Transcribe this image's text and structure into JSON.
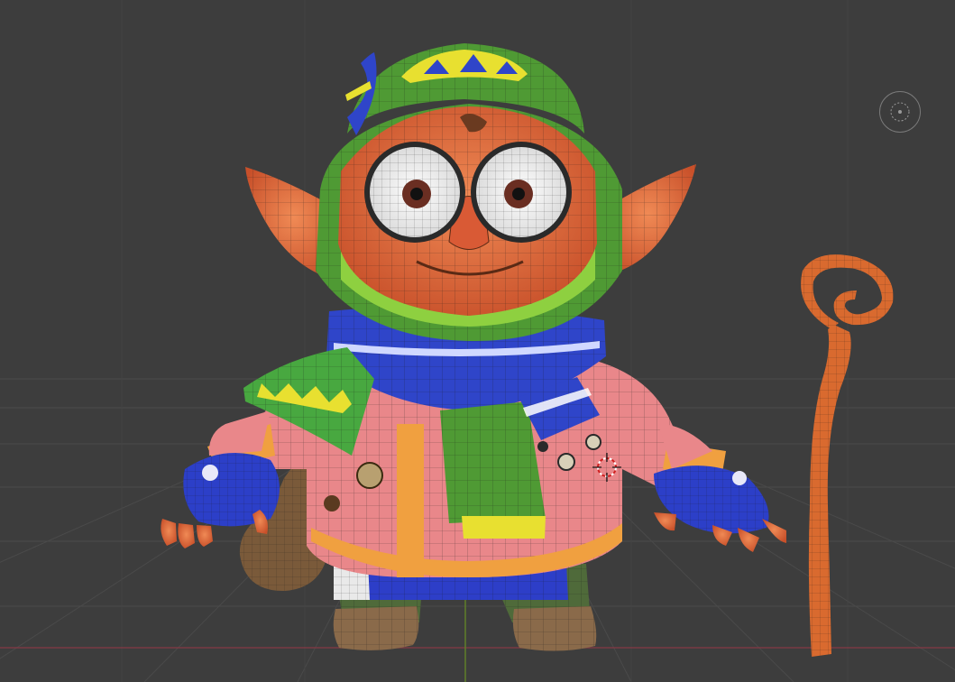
{
  "viewport": {
    "type": "3d-viewport",
    "mode": "solid-shading-with-wireframe-overlay",
    "background_color": "#3d3d3d",
    "grid_color": "#4a4a4a",
    "x_axis_color": "#7a3a44",
    "y_axis_color": "#5f7f2a"
  },
  "objects": [
    {
      "name": "goblin-character",
      "colors": {
        "skin": "#e0663a",
        "hat": "#4f9a34",
        "scarf": "#2f45c9",
        "coat": "#e9878a",
        "gloves": "#2c3fc8"
      }
    },
    {
      "name": "walking-staff",
      "colors": {
        "wood": "#d96a2f"
      }
    },
    {
      "name": "sack-bag",
      "colors": {
        "cloth": "#7a5a3a"
      }
    }
  ],
  "overlays": {
    "3d_cursor": "cursor-3d-icon",
    "navigation_gizmo": "view-gizmo-icon"
  }
}
